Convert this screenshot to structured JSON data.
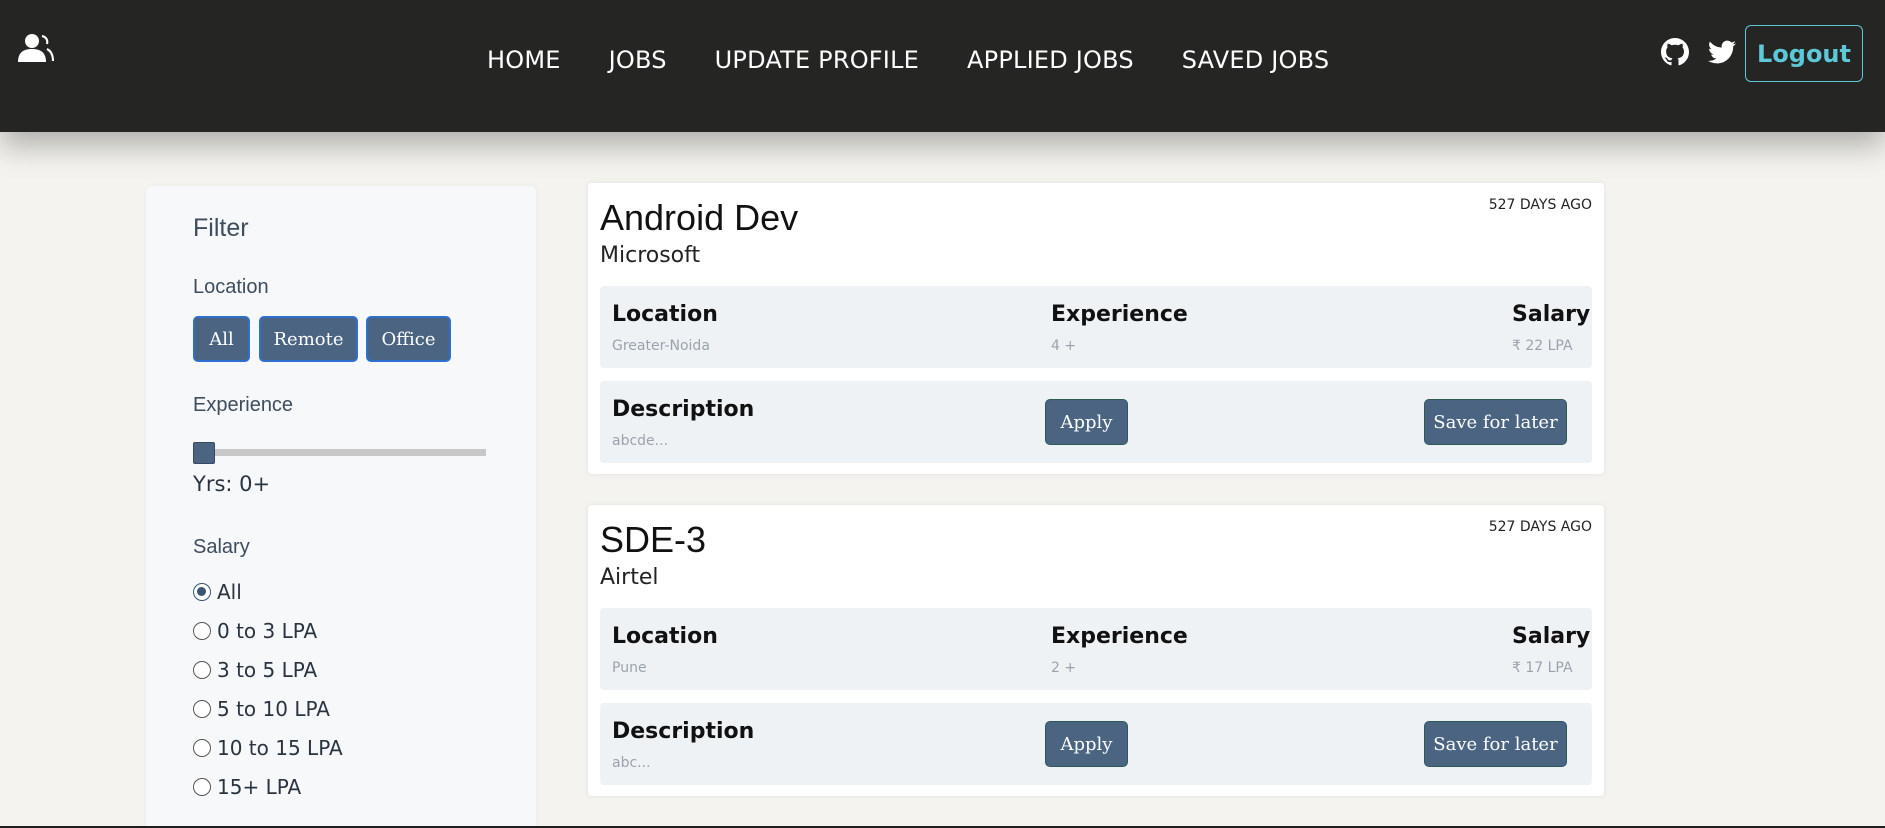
{
  "nav": {
    "links": [
      "HOME",
      "JOBS",
      "UPDATE PROFILE",
      "APPLIED JOBS",
      "SAVED JOBS"
    ],
    "logout": "Logout"
  },
  "filter": {
    "title": "Filter",
    "location_label": "Location",
    "location_options": [
      "All",
      "Remote",
      "Office"
    ],
    "experience_label": "Experience",
    "experience_value": 0,
    "years_text": "Yrs: 0+",
    "salary_label": "Salary",
    "salary_options": [
      "All",
      "0 to 3 LPA",
      "3 to 5 LPA",
      "5 to 10 LPA",
      "10 to 15 LPA",
      "15+ LPA"
    ],
    "salary_selected": "All"
  },
  "jobs": [
    {
      "title": "Android Dev",
      "company": "Microsoft",
      "posted": "527 DAYS AGO",
      "location_label": "Location",
      "location": "Greater-Noida",
      "experience_label": "Experience",
      "experience": "4 +",
      "salary_label": "Salary",
      "salary": "₹ 22 LPA",
      "description_label": "Description",
      "description": "abcde...",
      "apply": "Apply",
      "save": "Save for later"
    },
    {
      "title": "SDE-3",
      "company": "Airtel",
      "posted": "527 DAYS AGO",
      "location_label": "Location",
      "location": "Pune",
      "experience_label": "Experience",
      "experience": "2 +",
      "salary_label": "Salary",
      "salary": "₹ 17 LPA",
      "description_label": "Description",
      "description": "abc...",
      "apply": "Apply",
      "save": "Save for later"
    }
  ],
  "icons": {
    "brand": "user-group-icon",
    "github": "github-icon",
    "twitter": "twitter-icon"
  },
  "colors": {
    "navbar": "#252523",
    "button": "#4a6482",
    "logout": "#5cc8d8"
  }
}
